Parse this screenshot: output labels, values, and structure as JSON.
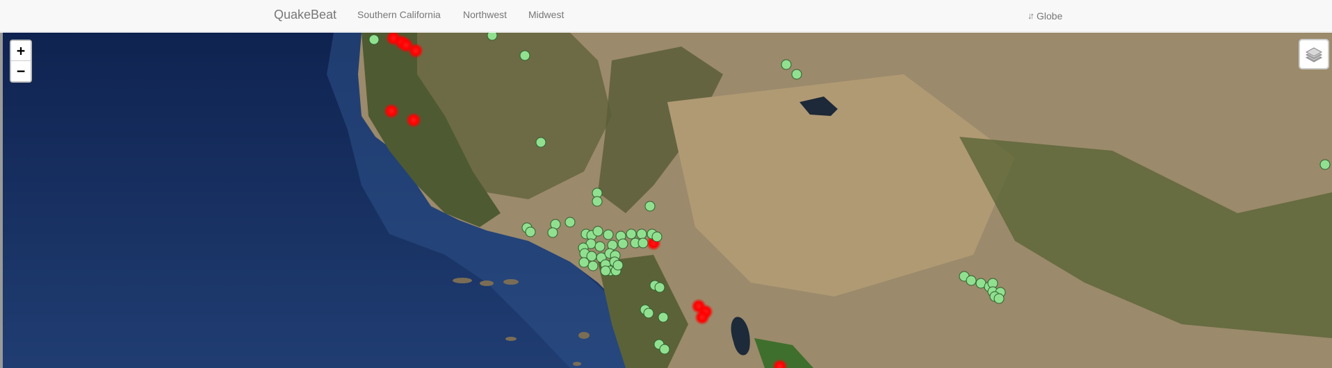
{
  "navbar": {
    "brand": "QuakeBeat",
    "links": [
      "Southern California",
      "Northwest",
      "Midwest"
    ],
    "globe_label": "Globe",
    "globe_icon": "sort-icon"
  },
  "map": {
    "zoom_in_label": "+",
    "zoom_out_label": "−",
    "layers_icon": "layers-icon",
    "colors": {
      "ocean": "#1b3366",
      "land": "#9c8a6a",
      "vegetation": "#4f5f33",
      "quake_recent": "#ff0000",
      "quake_marker": "#90e090",
      "quake_marker_stroke": "#2e5e2e"
    },
    "marker_groups": {
      "recent_quakes": "red",
      "older_quakes": "green"
    }
  }
}
